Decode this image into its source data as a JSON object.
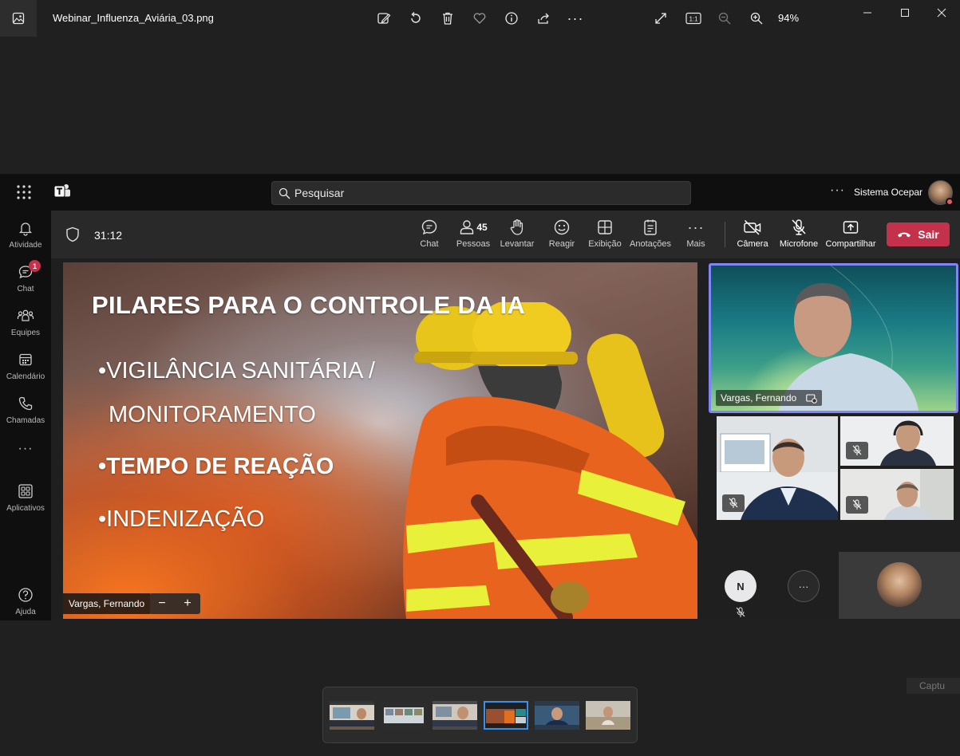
{
  "viewer": {
    "file_name": "Webinar_Influenza_Aviária_03.png",
    "zoom": "94%"
  },
  "teams": {
    "search_placeholder": "Pesquisar",
    "account_name": "Sistema Ocepar",
    "rail": {
      "atividade": "Atividade",
      "chat": "Chat",
      "chat_badge": "1",
      "equipes": "Equipes",
      "calendario": "Calendário",
      "chamadas": "Chamadas",
      "aplicativos": "Aplicativos",
      "ajuda": "Ajuda"
    },
    "meeting": {
      "timer": "31:12",
      "chat": "Chat",
      "people_count": "45",
      "pessoas": "Pessoas",
      "levantar": "Levantar",
      "reagir": "Reagir",
      "exibicao": "Exibição",
      "anotacoes": "Anotações",
      "mais": "Mais",
      "camera": "Câmera",
      "microfone": "Microfone",
      "compartilhar": "Compartilhar",
      "sair": "Sair"
    },
    "slide": {
      "title": "PILARES PARA O CONTROLE DA IA",
      "bullet1_line1": "•VIGILÂNCIA SANITÁRIA /",
      "bullet1_line2": "MONITORAMENTO",
      "bullet2": "•TEMPO DE REAÇÃO",
      "bullet3": "•INDENIZAÇÃO"
    },
    "presenter_name": "Vargas, Fernando",
    "main_tile_name": "Vargas, Fernando",
    "overflow_initial": "N",
    "overflow_more": "···"
  },
  "ghost_text": "Captu"
}
